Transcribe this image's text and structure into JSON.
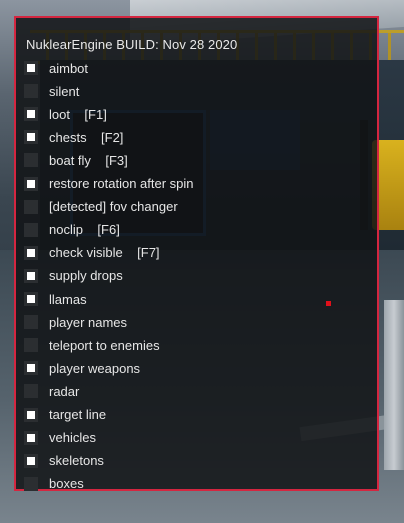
{
  "menu": {
    "title": "NuklearEngine BUILD: Nov 28 2020",
    "border_color": "#d42640",
    "options": [
      {
        "label": "aimbot",
        "checked": true
      },
      {
        "label": "silent",
        "checked": false
      },
      {
        "label": "loot    [F1]",
        "checked": true
      },
      {
        "label": "chests    [F2]",
        "checked": true
      },
      {
        "label": "boat fly    [F3]",
        "checked": false
      },
      {
        "label": "restore rotation after spin",
        "checked": true
      },
      {
        "label": "[detected] fov changer",
        "checked": false
      },
      {
        "label": "noclip    [F6]",
        "checked": false
      },
      {
        "label": "check visible    [F7]",
        "checked": true
      },
      {
        "label": "supply drops",
        "checked": true
      },
      {
        "label": "llamas",
        "checked": true
      },
      {
        "label": "player names",
        "checked": false
      },
      {
        "label": "teleport to enemies",
        "checked": false
      },
      {
        "label": "player weapons",
        "checked": true
      },
      {
        "label": "radar",
        "checked": false
      },
      {
        "label": "target line",
        "checked": true
      },
      {
        "label": "vehicles",
        "checked": true
      },
      {
        "label": "skeletons",
        "checked": true
      },
      {
        "label": "boxes",
        "checked": false
      }
    ]
  },
  "crosshair_marker_color": "#e0101a"
}
